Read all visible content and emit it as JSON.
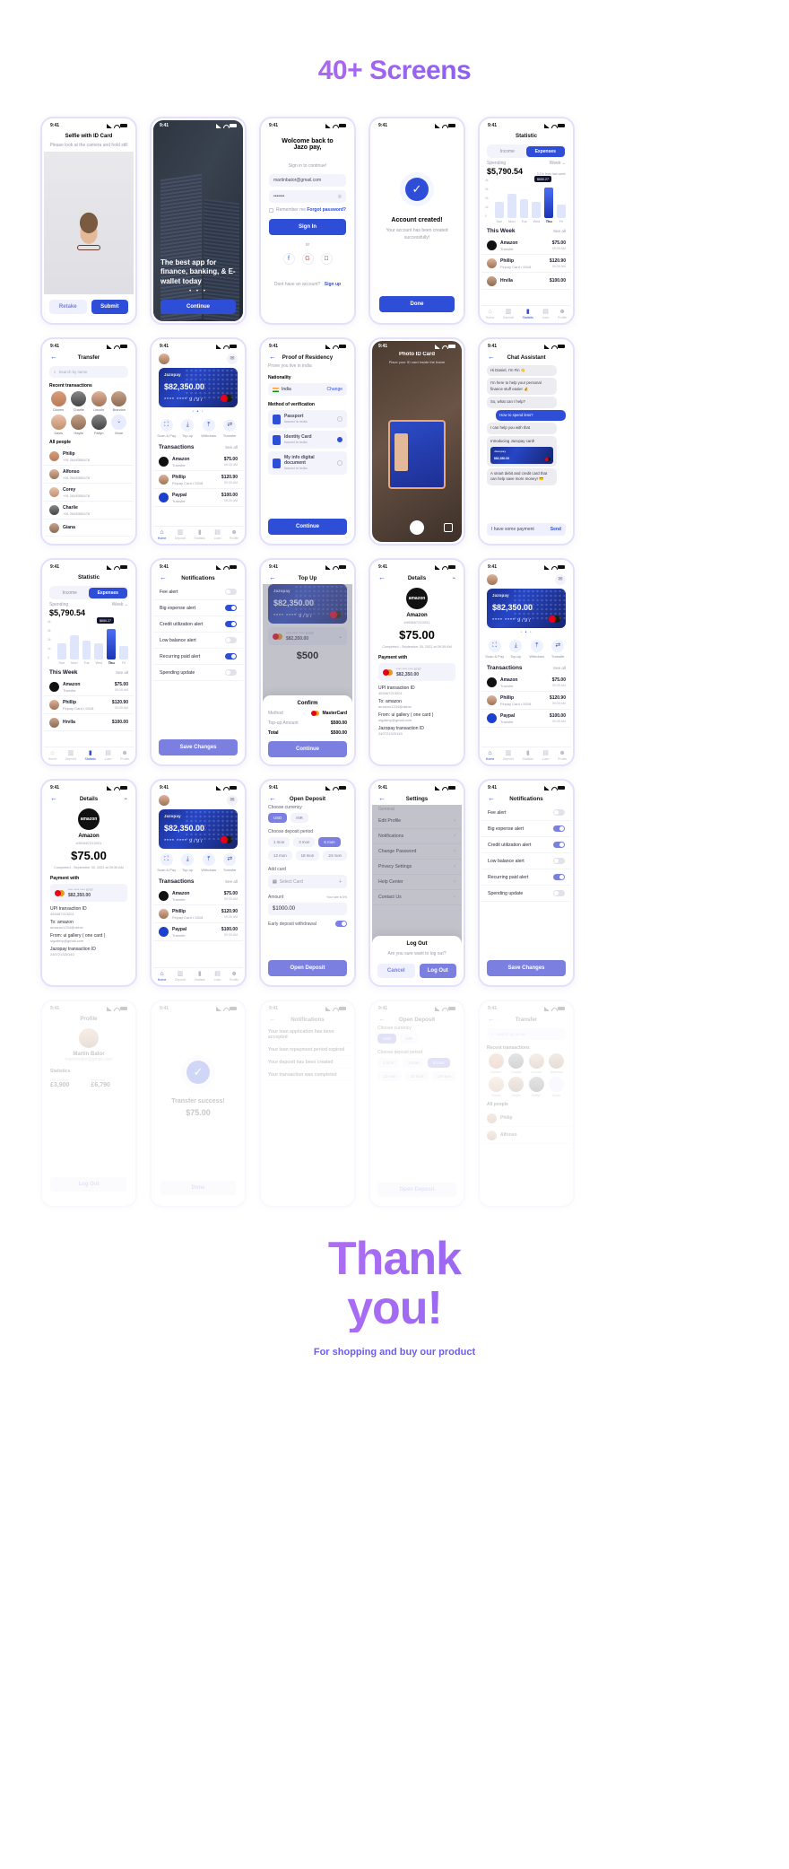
{
  "header": {
    "title": "40+ Screens"
  },
  "footer": {
    "thanks_line1": "Thank",
    "thanks_line2": "you!",
    "subtitle": "For shopping and buy our product"
  },
  "common": {
    "time": "9:41",
    "see_all": "See all",
    "tabs": [
      "Home",
      "Deposit",
      "Statistic",
      "Loan",
      "Profile"
    ]
  },
  "screens": {
    "selfie": {
      "title": "Selfie with ID Card",
      "subtitle": "Please look at the camera and hold still",
      "retake": "Retake",
      "submit": "Submit"
    },
    "onboarding": {
      "headline": "The best app for finance, banking, & E-wallet today",
      "cta": "Continue"
    },
    "signin": {
      "title_line1": "Wolcome back to",
      "title_line2": "Jazo pay,",
      "subtitle": "Sign in to continue!",
      "email": "martinbator@gmail.com",
      "password": "•••••••",
      "remember": "Remember me",
      "forgot": "Forgot password?",
      "submit": "Sign In",
      "or": "or",
      "socials": [
        "facebook-icon",
        "google-icon",
        "apple-icon"
      ],
      "signup_prompt": "Dont have an account?",
      "signup_link": "Sign up"
    },
    "account_created": {
      "title": "Account created!",
      "subtitle": "Your account has been created successfully!",
      "cta": "Done"
    },
    "statistic": {
      "title": "Statistic",
      "tab_income": "Income",
      "tab_expenses": "Expenses",
      "spending_label": "Spending",
      "period": "Week",
      "amount": "$5,790.54",
      "delta": "3.1% from last week",
      "section_title": "This Week",
      "transactions": [
        {
          "name": "Amazon",
          "sub": "Transfer",
          "amount": "$75.00",
          "time": "09:39 AM"
        },
        {
          "name": "Phillip",
          "sub": "Finpay Card • 5318",
          "amount": "$120.90",
          "time": "09:39 AM"
        },
        {
          "name": "Hrvlla",
          "sub": "Transfer",
          "amount": "$100.00",
          "time": "09:39 AM"
        }
      ]
    },
    "statistic_expenses": {
      "title": "Statistic",
      "tab_income": "Income",
      "tab_expenses": "Expenses",
      "spending_label": "Spending",
      "period": "Week",
      "amount": "$5,790.54",
      "section_title": "This Week",
      "transactions": [
        {
          "name": "Amazon",
          "sub": "Transfer",
          "amount": "$75.00",
          "time": "09:39 AM"
        },
        {
          "name": "Phillip",
          "sub": "Finpay Card • 5318",
          "amount": "$120.90",
          "time": "09:39 AM"
        },
        {
          "name": "Hrvlla",
          "sub": "Transfer",
          "amount": "$100.00",
          "time": "09:39 AM"
        }
      ]
    },
    "transfer": {
      "title": "Transfer",
      "search_placeholder": "Search by name",
      "recent_title": "Recent transactions",
      "recent": [
        "Dionne",
        "Charlie",
        "Lincoln",
        "Brandon",
        "Davis",
        "Haylie",
        "Paityn",
        "More"
      ],
      "all_title": "All people",
      "people": [
        {
          "name": "Philip",
          "phone": "+91 2649355476"
        },
        {
          "name": "Alfonso",
          "phone": "+91 2649355476"
        },
        {
          "name": "Corey",
          "phone": "+91 2649355476"
        },
        {
          "name": "Charlie",
          "phone": "+91 2649355476"
        },
        {
          "name": "Giana",
          "phone": "+91 2649355476"
        }
      ]
    },
    "home": {
      "card_brand": "Jazopay",
      "balance": "$82,350.00",
      "card_number": "**** **** 9797",
      "actions": [
        "Scan & Pay",
        "Top-up",
        "Withdraw",
        "Transfer"
      ],
      "tx_title": "Transactions",
      "transactions": [
        {
          "name": "Amazon",
          "sub": "Transfer",
          "amount": "$75.00",
          "time": "09:39 AM"
        },
        {
          "name": "Phillip",
          "sub": "Finpay Card • 5318",
          "amount": "$120.90",
          "time": "09:39 AM"
        },
        {
          "name": "Paypal",
          "sub": "Transfer",
          "amount": "$100.00",
          "time": "09:39 AM"
        }
      ]
    },
    "residency": {
      "title": "Proof of Residency",
      "subtitle": "Prove you live in india",
      "nationality_label": "Nationality",
      "country": "India",
      "change": "Change",
      "method_label": "Method of verification",
      "methods": [
        {
          "name": "Passport",
          "sub": "Issued in india",
          "selected": false
        },
        {
          "name": "Identity Card",
          "sub": "Issued in india",
          "selected": true
        },
        {
          "name": "My info digital document",
          "sub": "Issued in india",
          "selected": false
        }
      ],
      "cta": "Continue"
    },
    "photo_id": {
      "title": "Photo ID Card",
      "subtitle": "Place your ID card inside the frame"
    },
    "chat": {
      "title": "Chat Assistant",
      "messages": [
        {
          "from": "bot",
          "text": "Hi Daniel, I'm Fin 👋"
        },
        {
          "from": "bot",
          "text": "I'm here to help your personal finance stuff easier 💰"
        },
        {
          "from": "bot",
          "text": "So, what can I help?"
        },
        {
          "from": "me",
          "text": "How to spend less?"
        },
        {
          "from": "bot",
          "text": "I can help you with that"
        },
        {
          "from": "bot",
          "text": "Introducing Jazopay card!"
        },
        {
          "from": "bot",
          "text": "A smart debit and credit card that can help save more money! 💳"
        }
      ],
      "input_value": "I have some payment",
      "send": "Send"
    },
    "notifications": {
      "title": "Notifications",
      "items": [
        {
          "label": "Fee alert",
          "on": false
        },
        {
          "label": "Big expense alert",
          "on": true
        },
        {
          "label": "Credit utilization alert",
          "on": true
        },
        {
          "label": "Low balance alert",
          "on": false
        },
        {
          "label": "Recurring paid alert",
          "on": true
        },
        {
          "label": "Spending update",
          "on": false
        }
      ],
      "cta": "Save Changes"
    },
    "topup": {
      "title": "Top Up",
      "balance": "$82,350.00",
      "card_number": "**** **** 9797",
      "selected_card_number": "**** **** **** 9797",
      "selected_card_balance": "$82,350.00",
      "amount": "$500",
      "confirm_title": "Confirm",
      "method_label": "Method",
      "method_value": "MasterCard",
      "topup_label": "Top-up Amount",
      "topup_value": "$500.00",
      "total_label": "Total",
      "total_value": "$500.00",
      "cta": "Continue"
    },
    "details": {
      "title": "Details",
      "merchant": "Amazon",
      "reference": "#453467213201",
      "amount": "$75.00",
      "status": "Completed - September 30, 2022 at 09:39 AM",
      "payment_with": "Payment with",
      "card_number": "**** **** **** 9797",
      "card_balance": "$82,350.00",
      "rows": [
        {
          "label": "UPI transaction ID",
          "value": "453467213201"
        },
        {
          "label": "To: amazon",
          "value": "amazon1234@okbsl"
        },
        {
          "label": "From: ui gallery ( one card )",
          "value": "uigallery@gmail.com"
        },
        {
          "label": "Jazopay transaction ID",
          "value": "240721320145"
        }
      ]
    },
    "open_deposit": {
      "title": "Open Deposit",
      "currency_label": "Choose currency",
      "currencies": [
        "USD",
        "INR"
      ],
      "currency_selected": "USD",
      "period_label": "Choose deposit period",
      "periods": [
        "1 mon",
        "3 mon",
        "6 mon",
        "12 mon",
        "18 mon",
        "24 mon"
      ],
      "period_selected": "6 mon",
      "add_card_label": "Add card",
      "select_card": "Select Card",
      "amount_label": "Amount",
      "rate_hint": "Your rate is 6%",
      "amount_value": "$1000.00",
      "early_label": "Early deposit withdrawal",
      "early_on": true,
      "cta": "Open Deposit"
    },
    "settings": {
      "title": "Settings",
      "group": "General",
      "items": [
        "Edit Profile",
        "Notifications",
        "Change Password",
        "Privacy Settings",
        "Help Center",
        "Contact Us"
      ],
      "logout_title": "Log Out",
      "logout_question": "Are you sure want to log out?",
      "cancel": "Cancel",
      "confirm": "Log Out"
    },
    "profile": {
      "title": "Profile",
      "name": "Martin Bator",
      "email": "martinbator@gmail.com",
      "statistics": "Statistics",
      "income_label": "Net Income",
      "income_value": "£3,900",
      "expense_label": "Expense",
      "expense_value": "£6,790"
    },
    "transfer_success": {
      "title": "Transfer success!",
      "amount": "$75.00"
    }
  }
}
